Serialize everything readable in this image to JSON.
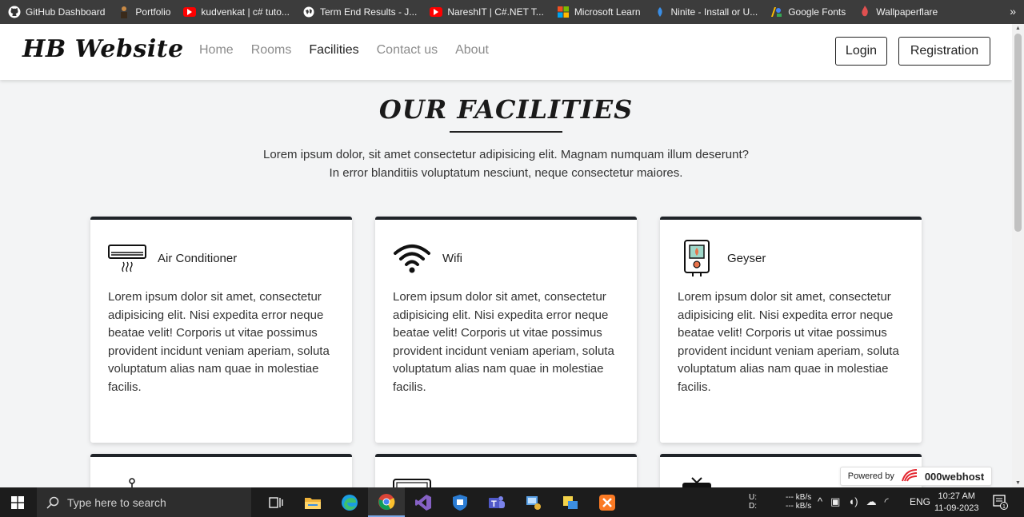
{
  "bookmarks": [
    {
      "label": "GitHub Dashboard",
      "icon": "github-icon",
      "color": "#ffffff"
    },
    {
      "label": "Portfolio",
      "icon": "person-icon",
      "color": "#c98a45"
    },
    {
      "label": "kudvenkat | c# tuto...",
      "icon": "youtube-icon",
      "color": "#ff0000"
    },
    {
      "label": "Term End Results - J...",
      "icon": "globe-icon",
      "color": "#ffffff"
    },
    {
      "label": "NareshIT | C#.NET T...",
      "icon": "youtube-icon",
      "color": "#ff0000"
    },
    {
      "label": "Microsoft Learn",
      "icon": "microsoft-icon",
      "color": "#f25022"
    },
    {
      "label": "Ninite - Install or U...",
      "icon": "ninite-icon",
      "color": "#3a8ee6"
    },
    {
      "label": "Google Fonts",
      "icon": "google-fonts-icon",
      "color": "#fbbc04"
    },
    {
      "label": "Wallpaperflare",
      "icon": "wallpaperflare-icon",
      "color": "#e05050"
    }
  ],
  "bookmarks_more": "»",
  "navbar": {
    "brand": "HB Website",
    "links": [
      "Home",
      "Rooms",
      "Facilities",
      "Contact us",
      "About"
    ],
    "active_link": "Facilities",
    "login": "Login",
    "registration": "Registration"
  },
  "section": {
    "title": "OUR FACILITIES",
    "intro_line1": "Lorem ipsum dolor, sit amet consectetur adipisicing elit. Magnam numquam illum deserunt?",
    "intro_line2": "In error blanditiis voluptatum nesciunt, neque consectetur maiores."
  },
  "facilities": [
    {
      "title": "Air Conditioner",
      "icon": "air-conditioner-icon",
      "text": "Lorem ipsum dolor sit amet, consectetur adipisicing elit. Nisi expedita error neque beatae velit! Corporis ut vitae possimus provident incidunt veniam aperiam, soluta voluptatum alias nam quae in molestiae facilis."
    },
    {
      "title": "Wifi",
      "icon": "wifi-icon",
      "text": "Lorem ipsum dolor sit amet, consectetur adipisicing elit. Nisi expedita error neque beatae velit! Corporis ut vitae possimus provident incidunt veniam aperiam, soluta voluptatum alias nam quae in molestiae facilis."
    },
    {
      "title": "Geyser",
      "icon": "geyser-icon",
      "text": "Lorem ipsum dolor sit amet, consectetur adipisicing elit. Nisi expedita error neque beatae velit! Corporis ut vitae possimus provident incidunt veniam aperiam, soluta voluptatum alias nam quae in molestiae facilis."
    }
  ],
  "powered_by": {
    "label": "Powered by",
    "brand": "000webhost"
  },
  "taskbar": {
    "search_placeholder": "Type here to search",
    "net_up": "U:",
    "net_down": "D:",
    "speed_up": "--- kB/s",
    "speed_down": "--- kB/s",
    "language": "ENG",
    "time": "10:27 AM",
    "date": "11-09-2023",
    "notification_count": "1"
  }
}
